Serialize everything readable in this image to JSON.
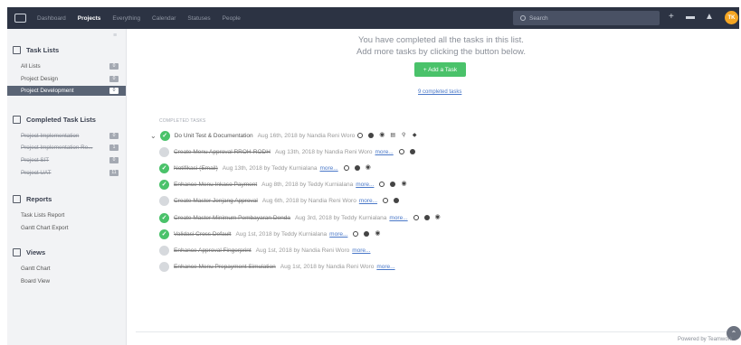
{
  "topbar": {
    "nav": [
      "Dashboard",
      "Projects",
      "Everything",
      "Calendar",
      "Statuses",
      "People"
    ],
    "active_nav": "Projects",
    "search_placeholder": "Search",
    "avatar_initials": "TK"
  },
  "sidebar": {
    "task_lists_heading": "Task Lists",
    "task_lists": [
      {
        "label": "All Lists",
        "count": "0"
      },
      {
        "label": "Project Design",
        "count": "0"
      },
      {
        "label": "Project Development",
        "count": "0"
      }
    ],
    "completed_heading": "Completed Task Lists",
    "completed_lists": [
      {
        "label": "Project Implementation",
        "count": "0"
      },
      {
        "label": "Project Implementation Re...",
        "count": "1"
      },
      {
        "label": "Project SIT",
        "count": "0"
      },
      {
        "label": "Project UAT",
        "count": "11"
      }
    ],
    "reports_heading": "Reports",
    "reports": [
      "Task Lists Report",
      "Gantt Chart Export"
    ],
    "views_heading": "Views",
    "views": [
      "Gantt Chart",
      "Board View"
    ]
  },
  "main": {
    "done_line1": "You have completed all the tasks in this list.",
    "done_line2": "Add more tasks by clicking the button below.",
    "add_task_label": "+ Add a Task",
    "completed_link": "9 completed tasks",
    "section_label": "COMPLETED TASKS",
    "more_label": "more...",
    "tasks": [
      {
        "name": "Do Unit Test & Documentation",
        "meta": "Aug 16th, 2018 by Nandia Reni Woro"
      },
      {
        "name": "Create Menu Approval RROH-RODH",
        "meta": "Aug 13th, 2018 by Nandia Reni Woro"
      },
      {
        "name": "Notifikasi (Email)",
        "meta": "Aug 13th, 2018 by Teddy Kurnialana"
      },
      {
        "name": "Enhance Menu Inkaso Payment",
        "meta": "Aug 8th, 2018 by Teddy Kurnialana"
      },
      {
        "name": "Create Master Jenjang Approval",
        "meta": "Aug 6th, 2018 by Nandia Reni Woro"
      },
      {
        "name": "Create Master Minimum Pembayaran Denda",
        "meta": "Aug 3rd, 2018 by Teddy Kurnialana"
      },
      {
        "name": "Validasi Cross Default",
        "meta": "Aug 1st, 2018 by Teddy Kurnialana"
      },
      {
        "name": "Enhance Approval Fingerprint",
        "meta": "Aug 1st, 2018 by Nandia Reni Woro"
      },
      {
        "name": "Enhance Menu Prepayment Simulation",
        "meta": "Aug 1st, 2018 by Nandia Reni Woro"
      }
    ]
  },
  "footer": {
    "powered_by": "Powered by Teamwork"
  },
  "colors": {
    "topbar": "#2c3343",
    "accent_green": "#4ac26a",
    "link": "#4a78c8",
    "avatar": "#f5a623"
  }
}
